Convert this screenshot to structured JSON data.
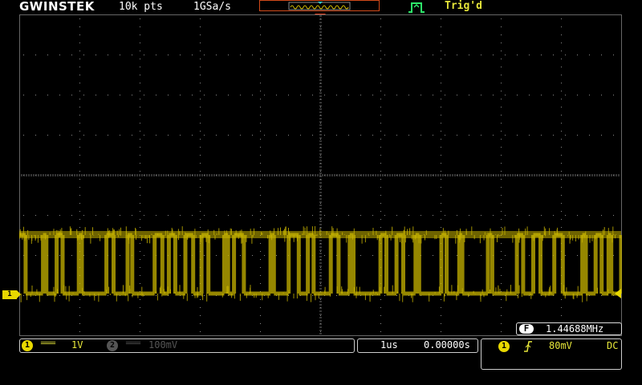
{
  "header": {
    "brand": "GWINSTEK",
    "record_length": "10k pts",
    "sample_rate": "1GSa/s",
    "trigger_status": "Trig'd"
  },
  "channels": {
    "ch1": {
      "label": "1",
      "coupling_symbol": "═══",
      "scale": "1V",
      "color": "#e8d800"
    },
    "ch2": {
      "label": "2",
      "coupling_symbol": "═══",
      "scale": "100mV",
      "color": "#555555"
    }
  },
  "timebase": {
    "scale": "1us",
    "position": "0.00000s"
  },
  "trigger": {
    "source": "1",
    "slope_icon": "rising-edge-icon",
    "level": "80mV",
    "coupling": "DC"
  },
  "measurement": {
    "badge": "F",
    "frequency": "1.44688MHz"
  },
  "colors": {
    "trace": "#c8b400",
    "trigger_marker": "#e04020",
    "trig_status": "#e6e63a"
  }
}
